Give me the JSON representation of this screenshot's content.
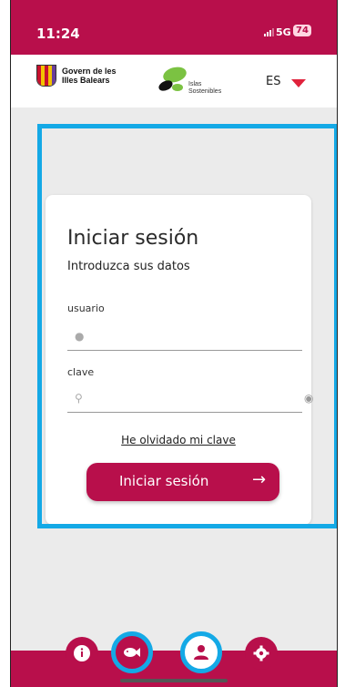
{
  "status_bar": {
    "time": "11:24",
    "network": "5G",
    "battery": "74"
  },
  "header": {
    "govern_logo_line1": "Govern de les",
    "govern_logo_line2": "Illes Balears",
    "islas_logo_line1": "Islas",
    "islas_logo_line2": "Sostenibles",
    "language": "ES"
  },
  "login": {
    "title": "Iniciar sesión",
    "subtitle": "Introduzca sus datos",
    "username_label": "usuario",
    "username_value": "",
    "password_label": "clave",
    "password_value": "",
    "forgot_link": "He olvidado mi clave",
    "submit_label": "Iniciar sesión"
  },
  "bottom_nav": {
    "items": [
      {
        "icon": "info-icon",
        "active": false
      },
      {
        "icon": "fish-icon",
        "active": false
      },
      {
        "icon": "user-icon",
        "active": true
      },
      {
        "icon": "gear-icon",
        "active": false
      }
    ]
  },
  "colors": {
    "brand": "#b80f4b",
    "highlight": "#14a9e6",
    "background": "#ebebeb",
    "lang_arrow": "#e0223c"
  }
}
